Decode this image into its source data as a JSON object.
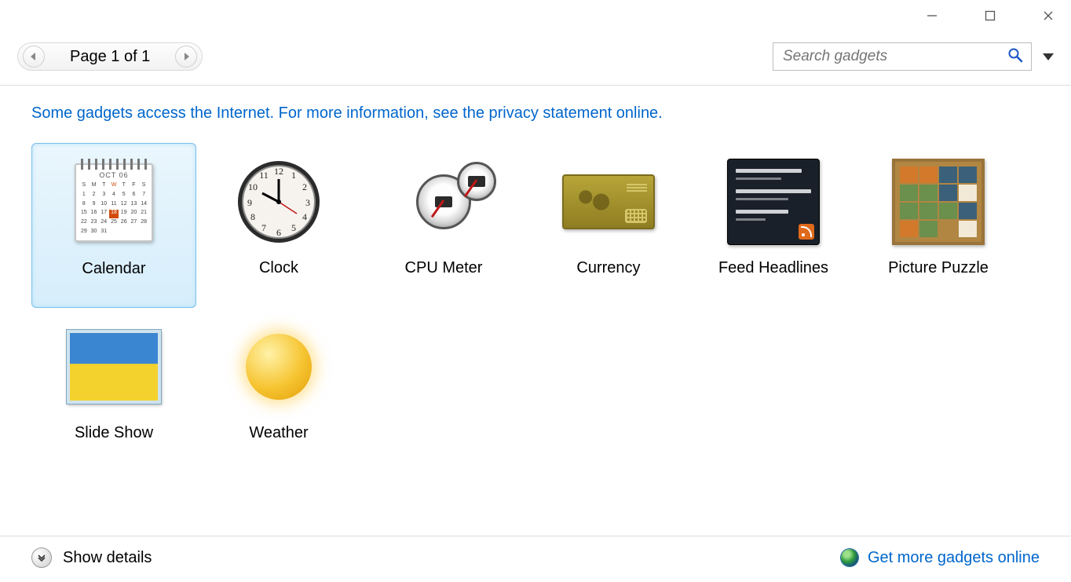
{
  "window": {
    "title": ""
  },
  "pager": {
    "label": "Page 1 of 1"
  },
  "search": {
    "placeholder": "Search gadgets"
  },
  "notice": "Some gadgets access the Internet.  For more information, see the privacy statement online.",
  "gadgets": [
    {
      "name": "Calendar",
      "selected": true
    },
    {
      "name": "Clock",
      "selected": false
    },
    {
      "name": "CPU Meter",
      "selected": false
    },
    {
      "name": "Currency",
      "selected": false
    },
    {
      "name": "Feed Headlines",
      "selected": false
    },
    {
      "name": "Picture Puzzle",
      "selected": false
    },
    {
      "name": "Slide Show",
      "selected": false
    },
    {
      "name": "Weather",
      "selected": false
    }
  ],
  "footer": {
    "details_label": "Show details",
    "online_link": "Get more gadgets online"
  }
}
